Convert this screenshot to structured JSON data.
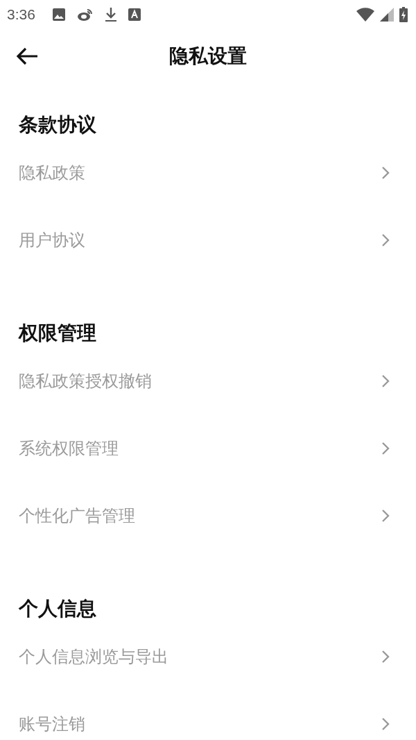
{
  "status_bar": {
    "time": "3:36"
  },
  "header": {
    "title": "隐私设置"
  },
  "sections": [
    {
      "heading": "条款协议",
      "items": [
        {
          "label": "隐私政策"
        },
        {
          "label": "用户协议"
        }
      ]
    },
    {
      "heading": "权限管理",
      "items": [
        {
          "label": "隐私政策授权撤销"
        },
        {
          "label": "系统权限管理"
        },
        {
          "label": "个性化广告管理"
        }
      ]
    },
    {
      "heading": "个人信息",
      "items": [
        {
          "label": "个人信息浏览与导出"
        },
        {
          "label": "账号注销"
        }
      ]
    }
  ]
}
